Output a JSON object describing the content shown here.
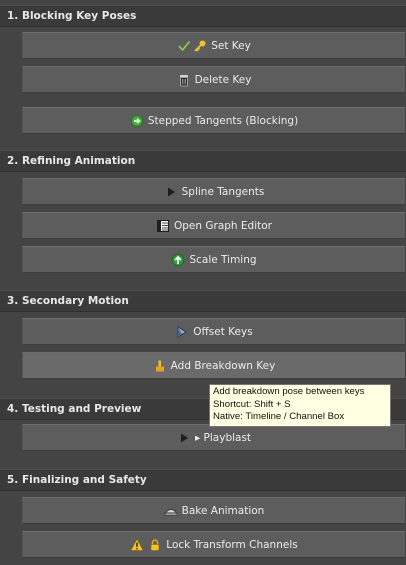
{
  "sections": [
    {
      "title": "1. Blocking Key Poses"
    },
    {
      "title": "2. Refining Animation"
    },
    {
      "title": "3. Secondary Motion"
    },
    {
      "title": "4. Testing and Preview"
    },
    {
      "title": "5. Finalizing and Safety"
    }
  ],
  "buttons": {
    "set_key": {
      "label": "Set Key",
      "icons": [
        "checkmark-icon",
        "key-icon"
      ]
    },
    "delete_key": {
      "label": "Delete Key",
      "icons": [
        "trash-icon"
      ]
    },
    "stepped_tangents": {
      "label": "Stepped Tangents (Blocking)",
      "icons": [
        "green-arrow-icon"
      ]
    },
    "spline_tangents": {
      "label": "Spline Tangents",
      "icons": [
        "play-triangle-icon"
      ]
    },
    "open_graph_editor": {
      "label": "Open Graph Editor",
      "icons": [
        "graph-editor-icon"
      ]
    },
    "scale_timing": {
      "label": "Scale Timing",
      "icons": [
        "green-up-arrow-icon"
      ]
    },
    "offset_keys": {
      "label": "Offset Keys",
      "icons": [
        "offset-icon"
      ]
    },
    "add_breakdown_key": {
      "label": "Add Breakdown Key",
      "icons": [
        "breakdown-key-icon"
      ]
    },
    "playblast": {
      "label": "▸ Playblast",
      "icons": [
        "play-triangle-icon"
      ]
    },
    "bake_animation": {
      "label": "Bake Animation",
      "icons": [
        "bake-icon"
      ]
    },
    "lock_transform": {
      "label": "Lock Transform Channels",
      "icons": [
        "warning-icon",
        "lock-icon"
      ]
    }
  },
  "tooltip": {
    "line1": "Add breakdown pose between keys",
    "line2": "Shortcut: Shift + S",
    "line3": "Native: Timeline / Channel Box"
  },
  "colors": {
    "background": "#444444",
    "header_bg": "#3a3a3a",
    "button_bg": "#5d5d5d",
    "button_hover_bg": "#6a6a6a",
    "tooltip_bg": "#ffffe1",
    "accent_green": "#3fae3a",
    "key_yellow": "#e8b92a"
  }
}
